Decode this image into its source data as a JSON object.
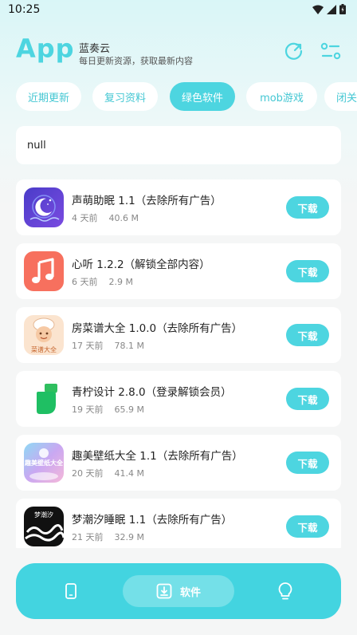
{
  "status_bar": {
    "time": "10:25"
  },
  "header": {
    "title": "App",
    "subtitle": "蓝奏云",
    "tagline": "每日更新资源，获取最新内容",
    "refresh_icon": "refresh-icon",
    "settings_icon": "settings-sliders-icon"
  },
  "tabs": [
    {
      "label": "近期更新",
      "active": false
    },
    {
      "label": "复习资料",
      "active": false
    },
    {
      "label": "绿色软件",
      "active": true
    },
    {
      "label": "mob游戏",
      "active": false
    },
    {
      "label": "闭关",
      "active": false
    }
  ],
  "notice": {
    "text": "null"
  },
  "apps": [
    {
      "name": "声萌助眠 1.1（去除所有广告）",
      "time": "4 天前",
      "size": "40.6 M",
      "button": "下载",
      "icon": "moon-sleep-icon"
    },
    {
      "name": "心听 1.2.2（解锁全部内容）",
      "time": "6 天前",
      "size": "2.9 M",
      "button": "下载",
      "icon": "music-note-icon"
    },
    {
      "name": "房菜谱大全 1.0.0（去除所有广告）",
      "time": "17 天前",
      "size": "78.1 M",
      "button": "下载",
      "icon": "chef-recipe-icon",
      "icon_text": "菜谱大全"
    },
    {
      "name": "青柠设计 2.8.0（登录解锁会员）",
      "time": "19 天前",
      "size": "65.9 M",
      "button": "下载",
      "icon": "green-leaf-icon"
    },
    {
      "name": "趣美壁纸大全 1.1（去除所有广告）",
      "time": "20 天前",
      "size": "41.4 M",
      "button": "下载",
      "icon": "wallpaper-icon",
      "icon_text": "趣美壁纸大全"
    },
    {
      "name": "梦潮汐睡眠 1.1（去除所有广告）",
      "time": "21 天前",
      "size": "32.9 M",
      "button": "下载",
      "icon": "wave-sleep-icon",
      "icon_text": "梦潮汐"
    }
  ],
  "bottom_nav": {
    "left_icon": "phone-icon",
    "center_label": "软件",
    "center_icon": "download-icon",
    "right_icon": "lightbulb-icon"
  },
  "colors": {
    "accent": "#4dd5e0",
    "nav_bg": "#43d4e0",
    "tab_text": "#44c7d3"
  }
}
